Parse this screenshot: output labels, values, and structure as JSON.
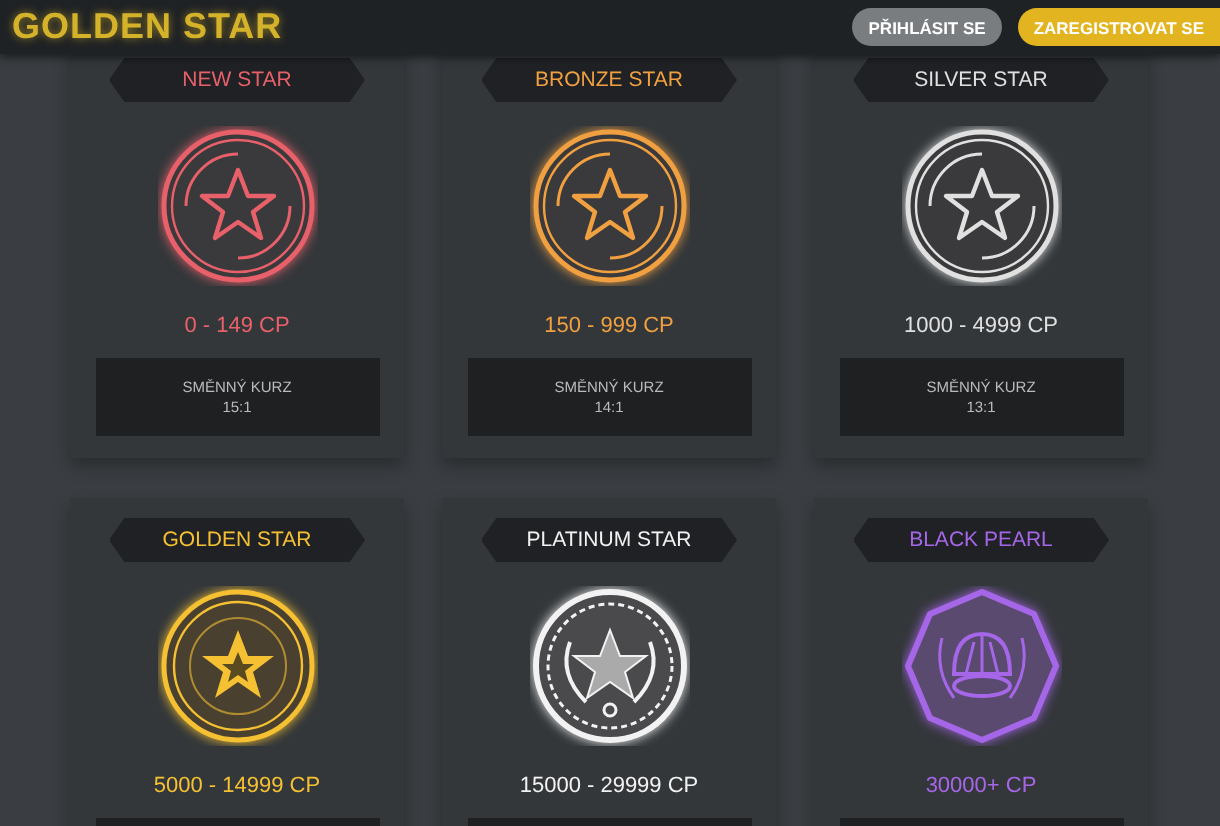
{
  "header": {
    "logo": "GOLDEN STAR",
    "buttons": [
      {
        "label": "PŘIHLÁSIT SE",
        "kind": "secondary"
      },
      {
        "label": "ZAREGISTROVAT SE",
        "kind": "primary"
      }
    ]
  },
  "tiers": [
    {
      "name": "NEW STAR",
      "color": "#e8606a",
      "kind": "ring-star",
      "range": "0 - 149 CP",
      "exchange": {
        "label": "SMĚNNÝ KURZ",
        "rate": "15:1"
      }
    },
    {
      "name": "BRONZE STAR",
      "color": "#f0a040",
      "kind": "ring-star",
      "range": "150 - 999 CP",
      "exchange": {
        "label": "SMĚNNÝ KURZ",
        "rate": "14:1"
      }
    },
    {
      "name": "SILVER STAR",
      "color": "#e0e0e0",
      "kind": "ring-star",
      "range": "1000 - 4999 CP",
      "exchange": {
        "label": "SMĚNNÝ KURZ",
        "rate": "13:1"
      }
    },
    {
      "name": "GOLDEN STAR",
      "color": "#f5c032",
      "kind": "solid-star",
      "range": "5000 - 14999 CP"
    },
    {
      "name": "PLATINUM STAR",
      "color": "#f2f2f2",
      "kind": "laurel-star",
      "range": "15000 - 29999 CP"
    },
    {
      "name": "BLACK PEARL",
      "color": "#a666e8",
      "kind": "pearl",
      "range": "30000+ CP"
    }
  ]
}
